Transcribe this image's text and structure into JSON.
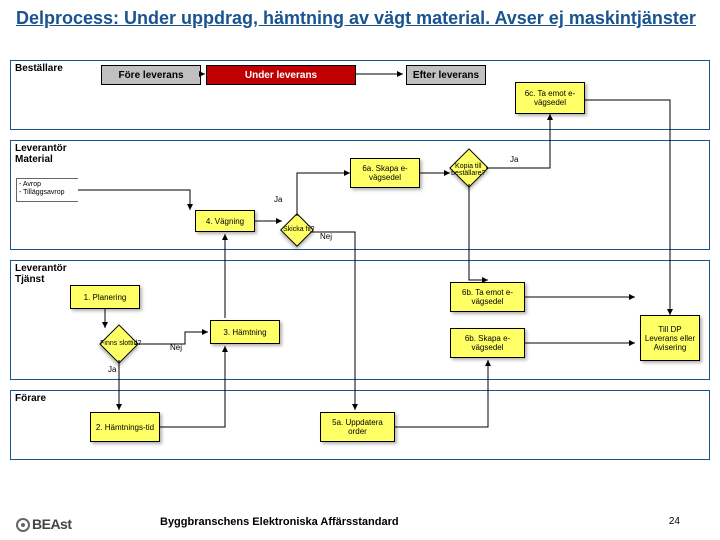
{
  "title": "Delprocess: Under uppdrag, hämtning av vägt material. Avser ej maskintjänster",
  "lanes": {
    "l1": "Beställare",
    "l2": "Leverantör Material",
    "l3": "Leverantör Tjänst",
    "l4": "Förare"
  },
  "phases": {
    "p1": "Före leverans",
    "p2": "Under leverans",
    "p3": "Efter leverans"
  },
  "boxes": {
    "b6c": "6c. Ta emot e-vägsedel",
    "b6a": "6a. Skapa e-vägsedel",
    "b4": "4. Vägning",
    "b1": "1. Planering",
    "b3": "3. Hämtning",
    "b6b_ta": "6b. Ta emot e-vägsedel",
    "b6b_sk": "6b. Skapa e-vägsedel",
    "b2": "2. Hämtnings-tid",
    "b5a": "5a. Uppdatera order",
    "bdp": "Till DP Leverans eller Avisering"
  },
  "diamonds": {
    "kopia": "Kopia till beställare?",
    "skicka": "Skicka fil?",
    "slot": "Finns slottid?"
  },
  "labels": {
    "ja": "Ja",
    "nej": "Nej"
  },
  "bracket": "- Avrop\n- Tilläggsavrop",
  "footer": "Byggbranschens Elektroniska Affärsstandard",
  "page": "24",
  "logo": "BEAst",
  "chart_data": {
    "type": "swimlane-flow",
    "lanes": [
      "Beställare",
      "Leverantör Material",
      "Leverantör Tjänst",
      "Förare"
    ],
    "phases": [
      "Före leverans",
      "Under leverans",
      "Efter leverans"
    ],
    "nodes": [
      {
        "id": "avrop",
        "lane": "Leverantör Material",
        "label": "- Avrop / - Tilläggsavrop",
        "type": "input"
      },
      {
        "id": "1",
        "lane": "Leverantör Tjänst",
        "label": "1. Planering",
        "type": "task"
      },
      {
        "id": "slot",
        "lane": "Leverantör Tjänst",
        "label": "Finns slottid?",
        "type": "decision"
      },
      {
        "id": "2",
        "lane": "Förare",
        "label": "2. Hämtningstid",
        "type": "task"
      },
      {
        "id": "3",
        "lane": "Leverantör Tjänst",
        "label": "3. Hämtning",
        "type": "task"
      },
      {
        "id": "4",
        "lane": "Leverantör Material",
        "label": "4. Vägning",
        "type": "task"
      },
      {
        "id": "skicka",
        "lane": "Leverantör Material",
        "label": "Skicka fil?",
        "type": "decision"
      },
      {
        "id": "5a",
        "lane": "Förare",
        "label": "5a. Uppdatera order",
        "type": "task"
      },
      {
        "id": "6a",
        "lane": "Leverantör Material",
        "label": "6a. Skapa e-vägsedel",
        "type": "task"
      },
      {
        "id": "kopia",
        "lane": "Leverantör Material",
        "label": "Kopia till beställare?",
        "type": "decision"
      },
      {
        "id": "6b_sk",
        "lane": "Leverantör Tjänst",
        "label": "6b. Skapa e-vägsedel",
        "type": "task"
      },
      {
        "id": "6b_ta",
        "lane": "Leverantör Tjänst",
        "label": "6b. Ta emot e-vägsedel",
        "type": "task"
      },
      {
        "id": "6c",
        "lane": "Beställare",
        "label": "6c. Ta emot e-vägsedel",
        "type": "task"
      },
      {
        "id": "dp",
        "lane": "Leverantör Tjänst",
        "label": "Till DP Leverans eller Avisering",
        "type": "end"
      }
    ],
    "edges": [
      {
        "from": "avrop",
        "to": "4"
      },
      {
        "from": "1",
        "to": "slot"
      },
      {
        "from": "slot",
        "to": "3",
        "label": "Nej"
      },
      {
        "from": "slot",
        "to": "2",
        "label": "Ja"
      },
      {
        "from": "2",
        "to": "3"
      },
      {
        "from": "3",
        "to": "4"
      },
      {
        "from": "4",
        "to": "skicka"
      },
      {
        "from": "skicka",
        "to": "6a",
        "label": "Ja"
      },
      {
        "from": "skicka",
        "to": "5a",
        "label": "Nej"
      },
      {
        "from": "6a",
        "to": "kopia"
      },
      {
        "from": "kopia",
        "to": "6c",
        "label": "Ja"
      },
      {
        "from": "kopia",
        "to": "6b_ta"
      },
      {
        "from": "5a",
        "to": "6b_sk"
      },
      {
        "from": "6b_sk",
        "to": "dp"
      },
      {
        "from": "6b_ta",
        "to": "dp"
      },
      {
        "from": "6c",
        "to": "dp"
      }
    ]
  }
}
